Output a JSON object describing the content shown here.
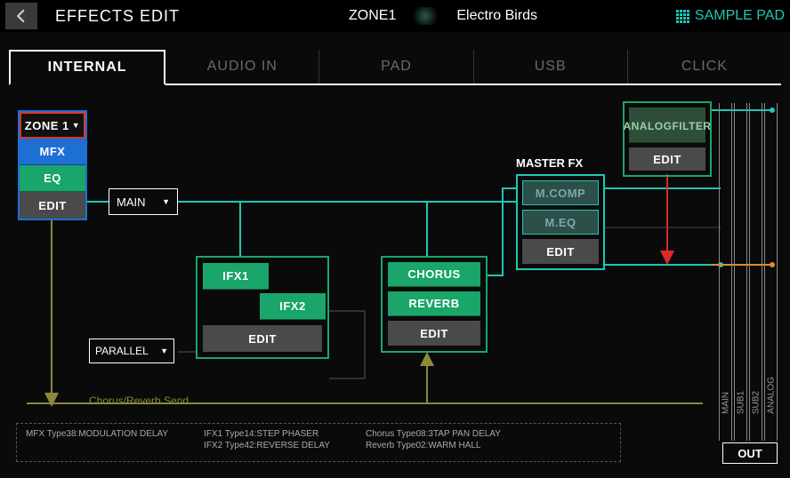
{
  "header": {
    "title": "EFFECTS EDIT",
    "zone": "ZONE1",
    "patch_name": "Electro Birds",
    "sample_pad": "SAMPLE PAD"
  },
  "tabs": {
    "items": [
      "INTERNAL",
      "AUDIO IN",
      "PAD",
      "USB",
      "CLICK"
    ],
    "active": 0
  },
  "zone_block": {
    "selector": "ZONE 1",
    "mfx": "MFX",
    "eq": "EQ",
    "edit": "EDIT"
  },
  "main_selector": "MAIN",
  "parallel_selector": "PARALLEL",
  "ifx_block": {
    "ifx1": "IFX1",
    "ifx2": "IFX2",
    "edit": "EDIT"
  },
  "cr_block": {
    "chorus": "CHORUS",
    "reverb": "REVERB",
    "edit": "EDIT"
  },
  "master_fx": {
    "label": "MASTER FX",
    "mcomp": "M.COMP",
    "meq": "M.EQ",
    "edit": "EDIT"
  },
  "analog_filter": {
    "line1": "ANALOG",
    "line2": "FILTER",
    "edit": "EDIT"
  },
  "outputs": {
    "channels": [
      "MAIN",
      "SUB1",
      "SUB2",
      "ANALOG"
    ],
    "label": "OUT"
  },
  "send_label": "Chorus/Reverb Send",
  "info": {
    "mfx": "MFX Type38:MODULATION DELAY",
    "ifx1": "IFX1 Type14:STEP PHASER",
    "ifx2": "IFX2 Type42:REVERSE DELAY",
    "chorus": "Chorus Type08:3TAP PAN DELAY",
    "reverb": "Reverb Type02:WARM HALL"
  },
  "colors": {
    "teal": "#1ec8b4",
    "green": "#1aa56a",
    "blue": "#1d6fd6",
    "red": "#d63a2a",
    "olive": "#8a8a3a",
    "orange": "#e88b2a"
  }
}
